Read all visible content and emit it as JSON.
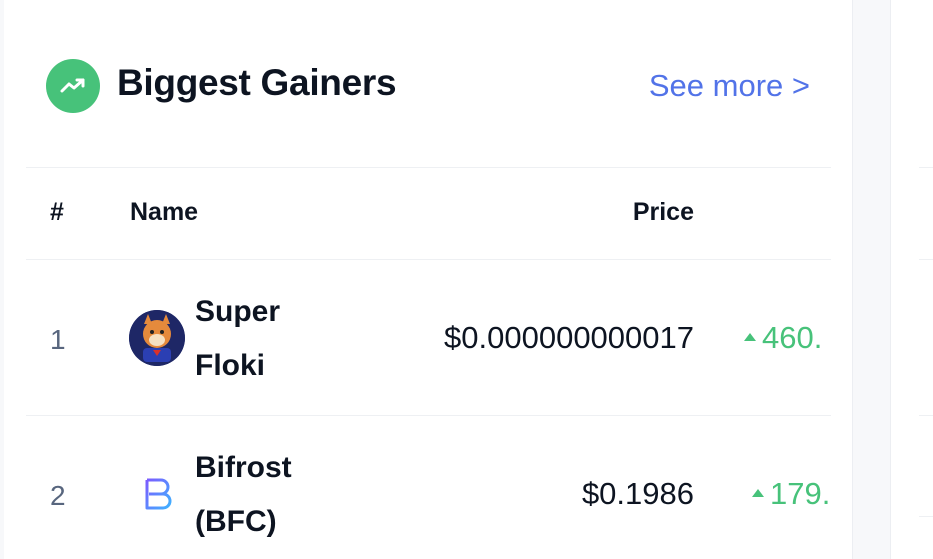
{
  "header": {
    "title": "Biggest Gainers",
    "see_more": "See more >"
  },
  "columns": {
    "rank": "#",
    "name": "Name",
    "price": "Price"
  },
  "rows": [
    {
      "rank": "1",
      "name": "Super Floki",
      "price": "$0.000000000017",
      "change": "460.",
      "icon": "super-floki-avatar"
    },
    {
      "rank": "2",
      "name": "Bifrost (BFC)",
      "price": "$0.1986",
      "change": "179.",
      "icon": "bifrost-logo"
    }
  ],
  "colors": {
    "accent_green": "#47c27a",
    "link_blue": "#5273e8",
    "text_dark": "#0d1421",
    "text_muted": "#58667e"
  }
}
